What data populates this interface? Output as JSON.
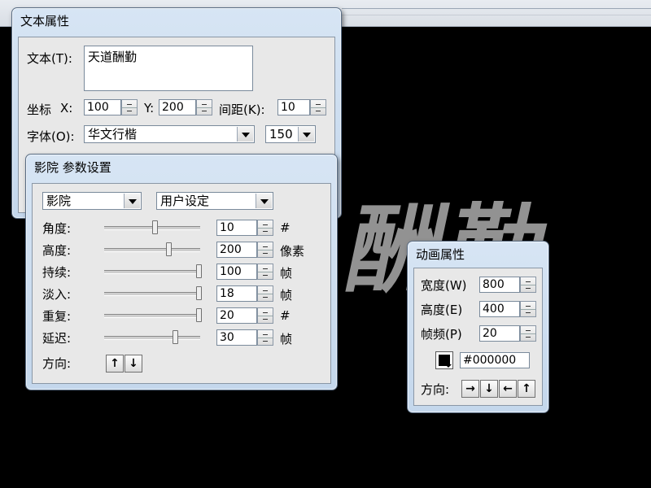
{
  "background_text": "酬勤",
  "text_props": {
    "title": "文本属性",
    "text_label": "文本(T):",
    "text_value": "天道酬勤",
    "coord_label": "坐标",
    "x_label": "X:",
    "x_value": "100",
    "y_label": "Y:",
    "y_value": "200",
    "spacing_label": "间距(K):",
    "spacing_value": "10",
    "font_label": "字体(O):",
    "font_value": "华文行楷",
    "size_value": "150"
  },
  "cinema": {
    "title": "影院 参数设置",
    "effect_select": "影院",
    "preset_select": "用户设定",
    "rows": [
      {
        "label": "角度:",
        "value": "10",
        "unit": "#",
        "level": 0.52
      },
      {
        "label": "高度:",
        "value": "200",
        "unit": "像素",
        "level": 0.67
      },
      {
        "label": "持续:",
        "value": "100",
        "unit": "帧",
        "level": 1.0
      },
      {
        "label": "淡入:",
        "value": "18",
        "unit": "帧",
        "level": 1.0
      },
      {
        "label": "重复:",
        "value": "20",
        "unit": "#",
        "level": 1.0
      },
      {
        "label": "延迟:",
        "value": "30",
        "unit": "帧",
        "level": 0.74
      }
    ],
    "direction_label": "方向:",
    "arrow_up": "↑",
    "arrow_down": "↓"
  },
  "anim": {
    "title": "动画属性",
    "width_label": "宽度(W)",
    "width_value": "800",
    "height_label": "高度(E)",
    "height_value": "400",
    "fps_label": "帧频(P)",
    "fps_value": "20",
    "color_value": "#000000",
    "direction_label": "方向:",
    "arrow_right": "→",
    "arrow_down": "↓",
    "arrow_left": "←",
    "arrow_up": "↑"
  },
  "colors": {
    "canvas": "#000000",
    "swatch": "#000000"
  }
}
